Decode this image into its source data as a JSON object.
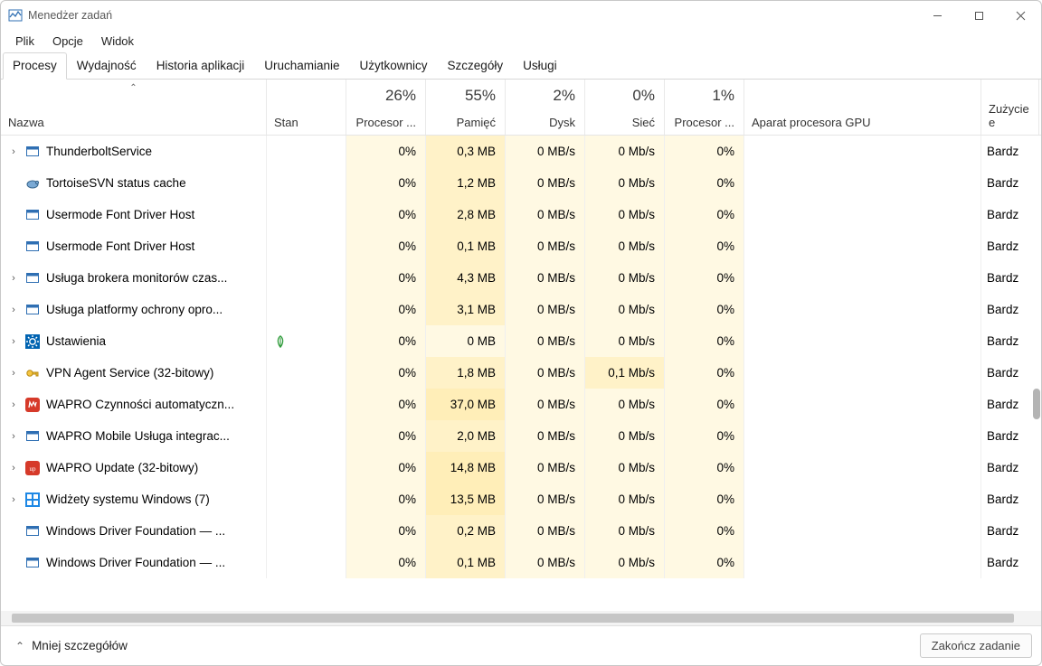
{
  "window": {
    "title": "Menedżer zadań"
  },
  "menu": {
    "items": [
      "Plik",
      "Opcje",
      "Widok"
    ]
  },
  "tabs": {
    "items": [
      "Procesy",
      "Wydajność",
      "Historia aplikacji",
      "Uruchamianie",
      "Użytkownicy",
      "Szczegóły",
      "Usługi"
    ],
    "active_index": 0
  },
  "columns": {
    "name": {
      "label": "Nazwa"
    },
    "state": {
      "label": "Stan"
    },
    "cpu": {
      "label": "Procesor ...",
      "summary": "26%"
    },
    "mem": {
      "label": "Pamięć",
      "summary": "55%"
    },
    "disk": {
      "label": "Dysk",
      "summary": "2%"
    },
    "net": {
      "label": "Sieć",
      "summary": "0%"
    },
    "gpu": {
      "label": "Procesor ...",
      "summary": "1%"
    },
    "gpu_engine": {
      "label": "Aparat procesora GPU"
    },
    "gpu_cons": {
      "label": "Zużycie e"
    }
  },
  "rows": [
    {
      "expandable": true,
      "icon": "generic-app",
      "name": "ThunderboltService",
      "state": "",
      "cpu": "0%",
      "mem": "0,3 MB",
      "disk": "0 MB/s",
      "net": "0 Mb/s",
      "gpu": "0%",
      "gpu_cons": "Bardz"
    },
    {
      "expandable": false,
      "icon": "tortoise",
      "name": "TortoiseSVN status cache",
      "state": "",
      "cpu": "0%",
      "mem": "1,2 MB",
      "disk": "0 MB/s",
      "net": "0 Mb/s",
      "gpu": "0%",
      "gpu_cons": "Bardz"
    },
    {
      "expandable": false,
      "icon": "generic-app",
      "name": "Usermode Font Driver Host",
      "state": "",
      "cpu": "0%",
      "mem": "2,8 MB",
      "disk": "0 MB/s",
      "net": "0 Mb/s",
      "gpu": "0%",
      "gpu_cons": "Bardz"
    },
    {
      "expandable": false,
      "icon": "generic-app",
      "name": "Usermode Font Driver Host",
      "state": "",
      "cpu": "0%",
      "mem": "0,1 MB",
      "disk": "0 MB/s",
      "net": "0 Mb/s",
      "gpu": "0%",
      "gpu_cons": "Bardz"
    },
    {
      "expandable": true,
      "icon": "generic-app",
      "name": "Usługa brokera monitorów czas...",
      "state": "",
      "cpu": "0%",
      "mem": "4,3 MB",
      "disk": "0 MB/s",
      "net": "0 Mb/s",
      "gpu": "0%",
      "gpu_cons": "Bardz"
    },
    {
      "expandable": true,
      "icon": "generic-app",
      "name": "Usługa platformy ochrony opro...",
      "state": "",
      "cpu": "0%",
      "mem": "3,1 MB",
      "disk": "0 MB/s",
      "net": "0 Mb/s",
      "gpu": "0%",
      "gpu_cons": "Bardz"
    },
    {
      "expandable": true,
      "icon": "settings",
      "name": "Ustawienia",
      "state": "leaf",
      "cpu": "0%",
      "mem": "0 MB",
      "disk": "0 MB/s",
      "net": "0 Mb/s",
      "gpu": "0%",
      "gpu_cons": "Bardz",
      "mem_low": true
    },
    {
      "expandable": true,
      "icon": "vpn-key",
      "name": "VPN Agent Service (32-bitowy)",
      "state": "",
      "cpu": "0%",
      "mem": "1,8 MB",
      "disk": "0 MB/s",
      "net": "0,1 Mb/s",
      "gpu": "0%",
      "gpu_cons": "Bardz",
      "net_hi": true
    },
    {
      "expandable": true,
      "icon": "wapro-red",
      "name": "WAPRO Czynności automatyczn...",
      "state": "",
      "cpu": "0%",
      "mem": "37,0 MB",
      "disk": "0 MB/s",
      "net": "0 Mb/s",
      "gpu": "0%",
      "gpu_cons": "Bardz",
      "mem_hi": true
    },
    {
      "expandable": true,
      "icon": "generic-app",
      "name": "WAPRO Mobile Usługa integrac...",
      "state": "",
      "cpu": "0%",
      "mem": "2,0 MB",
      "disk": "0 MB/s",
      "net": "0 Mb/s",
      "gpu": "0%",
      "gpu_cons": "Bardz"
    },
    {
      "expandable": true,
      "icon": "wapro-up",
      "name": "WAPRO Update (32-bitowy)",
      "state": "",
      "cpu": "0%",
      "mem": "14,8 MB",
      "disk": "0 MB/s",
      "net": "0 Mb/s",
      "gpu": "0%",
      "gpu_cons": "Bardz",
      "mem_hi": true
    },
    {
      "expandable": true,
      "icon": "widgets",
      "name": "Widżety systemu Windows (7)",
      "state": "",
      "cpu": "0%",
      "mem": "13,5 MB",
      "disk": "0 MB/s",
      "net": "0 Mb/s",
      "gpu": "0%",
      "gpu_cons": "Bardz",
      "mem_hi": true
    },
    {
      "expandable": false,
      "icon": "generic-app",
      "name": "Windows Driver Foundation — ...",
      "state": "",
      "cpu": "0%",
      "mem": "0,2 MB",
      "disk": "0 MB/s",
      "net": "0 Mb/s",
      "gpu": "0%",
      "gpu_cons": "Bardz"
    },
    {
      "expandable": false,
      "icon": "generic-app",
      "name": "Windows Driver Foundation — ...",
      "state": "",
      "cpu": "0%",
      "mem": "0,1 MB",
      "disk": "0 MB/s",
      "net": "0 Mb/s",
      "gpu": "0%",
      "gpu_cons": "Bardz"
    }
  ],
  "footer": {
    "fewer_details": "Mniej szczegółów",
    "end_task": "Zakończ zadanie"
  }
}
